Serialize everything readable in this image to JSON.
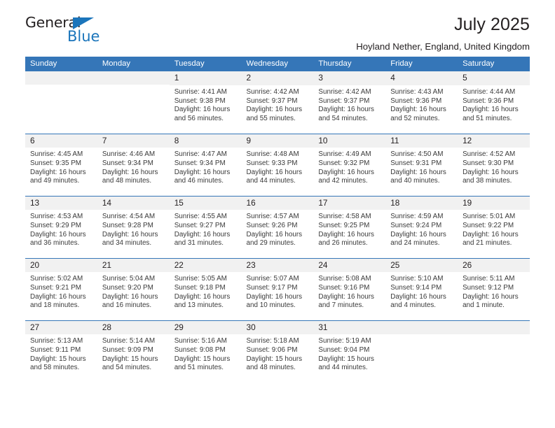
{
  "logo": {
    "word_top": "General",
    "word_bottom": "Blue",
    "triangle_icon": "blue-triangle-icon",
    "accent_color": "#1b75bb"
  },
  "header": {
    "title": "July 2025",
    "subtitle": "Hoyland Nether, England, United Kingdom"
  },
  "theme": {
    "header_blue": "#3576b8",
    "daynum_band": "#f1f1f1",
    "text": "#231f20"
  },
  "calendar": {
    "weekday_headers": [
      "Sunday",
      "Monday",
      "Tuesday",
      "Wednesday",
      "Thursday",
      "Friday",
      "Saturday"
    ],
    "weeks": [
      [
        {
          "day": "",
          "sunrise": "",
          "sunset": "",
          "daylight_a": "",
          "daylight_b": ""
        },
        {
          "day": "",
          "sunrise": "",
          "sunset": "",
          "daylight_a": "",
          "daylight_b": ""
        },
        {
          "day": "1",
          "sunrise": "Sunrise: 4:41 AM",
          "sunset": "Sunset: 9:38 PM",
          "daylight_a": "Daylight: 16 hours",
          "daylight_b": "and 56 minutes."
        },
        {
          "day": "2",
          "sunrise": "Sunrise: 4:42 AM",
          "sunset": "Sunset: 9:37 PM",
          "daylight_a": "Daylight: 16 hours",
          "daylight_b": "and 55 minutes."
        },
        {
          "day": "3",
          "sunrise": "Sunrise: 4:42 AM",
          "sunset": "Sunset: 9:37 PM",
          "daylight_a": "Daylight: 16 hours",
          "daylight_b": "and 54 minutes."
        },
        {
          "day": "4",
          "sunrise": "Sunrise: 4:43 AM",
          "sunset": "Sunset: 9:36 PM",
          "daylight_a": "Daylight: 16 hours",
          "daylight_b": "and 52 minutes."
        },
        {
          "day": "5",
          "sunrise": "Sunrise: 4:44 AM",
          "sunset": "Sunset: 9:36 PM",
          "daylight_a": "Daylight: 16 hours",
          "daylight_b": "and 51 minutes."
        }
      ],
      [
        {
          "day": "6",
          "sunrise": "Sunrise: 4:45 AM",
          "sunset": "Sunset: 9:35 PM",
          "daylight_a": "Daylight: 16 hours",
          "daylight_b": "and 49 minutes."
        },
        {
          "day": "7",
          "sunrise": "Sunrise: 4:46 AM",
          "sunset": "Sunset: 9:34 PM",
          "daylight_a": "Daylight: 16 hours",
          "daylight_b": "and 48 minutes."
        },
        {
          "day": "8",
          "sunrise": "Sunrise: 4:47 AM",
          "sunset": "Sunset: 9:34 PM",
          "daylight_a": "Daylight: 16 hours",
          "daylight_b": "and 46 minutes."
        },
        {
          "day": "9",
          "sunrise": "Sunrise: 4:48 AM",
          "sunset": "Sunset: 9:33 PM",
          "daylight_a": "Daylight: 16 hours",
          "daylight_b": "and 44 minutes."
        },
        {
          "day": "10",
          "sunrise": "Sunrise: 4:49 AM",
          "sunset": "Sunset: 9:32 PM",
          "daylight_a": "Daylight: 16 hours",
          "daylight_b": "and 42 minutes."
        },
        {
          "day": "11",
          "sunrise": "Sunrise: 4:50 AM",
          "sunset": "Sunset: 9:31 PM",
          "daylight_a": "Daylight: 16 hours",
          "daylight_b": "and 40 minutes."
        },
        {
          "day": "12",
          "sunrise": "Sunrise: 4:52 AM",
          "sunset": "Sunset: 9:30 PM",
          "daylight_a": "Daylight: 16 hours",
          "daylight_b": "and 38 minutes."
        }
      ],
      [
        {
          "day": "13",
          "sunrise": "Sunrise: 4:53 AM",
          "sunset": "Sunset: 9:29 PM",
          "daylight_a": "Daylight: 16 hours",
          "daylight_b": "and 36 minutes."
        },
        {
          "day": "14",
          "sunrise": "Sunrise: 4:54 AM",
          "sunset": "Sunset: 9:28 PM",
          "daylight_a": "Daylight: 16 hours",
          "daylight_b": "and 34 minutes."
        },
        {
          "day": "15",
          "sunrise": "Sunrise: 4:55 AM",
          "sunset": "Sunset: 9:27 PM",
          "daylight_a": "Daylight: 16 hours",
          "daylight_b": "and 31 minutes."
        },
        {
          "day": "16",
          "sunrise": "Sunrise: 4:57 AM",
          "sunset": "Sunset: 9:26 PM",
          "daylight_a": "Daylight: 16 hours",
          "daylight_b": "and 29 minutes."
        },
        {
          "day": "17",
          "sunrise": "Sunrise: 4:58 AM",
          "sunset": "Sunset: 9:25 PM",
          "daylight_a": "Daylight: 16 hours",
          "daylight_b": "and 26 minutes."
        },
        {
          "day": "18",
          "sunrise": "Sunrise: 4:59 AM",
          "sunset": "Sunset: 9:24 PM",
          "daylight_a": "Daylight: 16 hours",
          "daylight_b": "and 24 minutes."
        },
        {
          "day": "19",
          "sunrise": "Sunrise: 5:01 AM",
          "sunset": "Sunset: 9:22 PM",
          "daylight_a": "Daylight: 16 hours",
          "daylight_b": "and 21 minutes."
        }
      ],
      [
        {
          "day": "20",
          "sunrise": "Sunrise: 5:02 AM",
          "sunset": "Sunset: 9:21 PM",
          "daylight_a": "Daylight: 16 hours",
          "daylight_b": "and 18 minutes."
        },
        {
          "day": "21",
          "sunrise": "Sunrise: 5:04 AM",
          "sunset": "Sunset: 9:20 PM",
          "daylight_a": "Daylight: 16 hours",
          "daylight_b": "and 16 minutes."
        },
        {
          "day": "22",
          "sunrise": "Sunrise: 5:05 AM",
          "sunset": "Sunset: 9:18 PM",
          "daylight_a": "Daylight: 16 hours",
          "daylight_b": "and 13 minutes."
        },
        {
          "day": "23",
          "sunrise": "Sunrise: 5:07 AM",
          "sunset": "Sunset: 9:17 PM",
          "daylight_a": "Daylight: 16 hours",
          "daylight_b": "and 10 minutes."
        },
        {
          "day": "24",
          "sunrise": "Sunrise: 5:08 AM",
          "sunset": "Sunset: 9:16 PM",
          "daylight_a": "Daylight: 16 hours",
          "daylight_b": "and 7 minutes."
        },
        {
          "day": "25",
          "sunrise": "Sunrise: 5:10 AM",
          "sunset": "Sunset: 9:14 PM",
          "daylight_a": "Daylight: 16 hours",
          "daylight_b": "and 4 minutes."
        },
        {
          "day": "26",
          "sunrise": "Sunrise: 5:11 AM",
          "sunset": "Sunset: 9:12 PM",
          "daylight_a": "Daylight: 16 hours",
          "daylight_b": "and 1 minute."
        }
      ],
      [
        {
          "day": "27",
          "sunrise": "Sunrise: 5:13 AM",
          "sunset": "Sunset: 9:11 PM",
          "daylight_a": "Daylight: 15 hours",
          "daylight_b": "and 58 minutes."
        },
        {
          "day": "28",
          "sunrise": "Sunrise: 5:14 AM",
          "sunset": "Sunset: 9:09 PM",
          "daylight_a": "Daylight: 15 hours",
          "daylight_b": "and 54 minutes."
        },
        {
          "day": "29",
          "sunrise": "Sunrise: 5:16 AM",
          "sunset": "Sunset: 9:08 PM",
          "daylight_a": "Daylight: 15 hours",
          "daylight_b": "and 51 minutes."
        },
        {
          "day": "30",
          "sunrise": "Sunrise: 5:18 AM",
          "sunset": "Sunset: 9:06 PM",
          "daylight_a": "Daylight: 15 hours",
          "daylight_b": "and 48 minutes."
        },
        {
          "day": "31",
          "sunrise": "Sunrise: 5:19 AM",
          "sunset": "Sunset: 9:04 PM",
          "daylight_a": "Daylight: 15 hours",
          "daylight_b": "and 44 minutes."
        },
        {
          "day": "",
          "sunrise": "",
          "sunset": "",
          "daylight_a": "",
          "daylight_b": ""
        },
        {
          "day": "",
          "sunrise": "",
          "sunset": "",
          "daylight_a": "",
          "daylight_b": ""
        }
      ]
    ]
  }
}
